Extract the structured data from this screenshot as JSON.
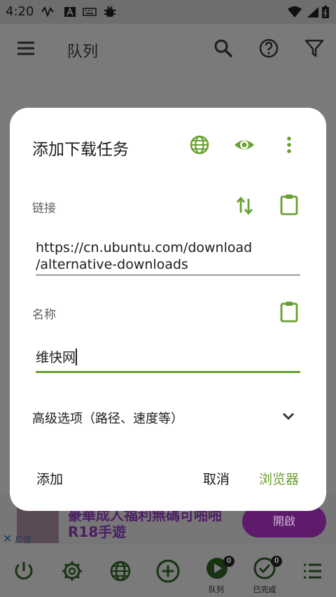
{
  "status_bar": {
    "time": "4:20"
  },
  "app_bar": {
    "title": "队列"
  },
  "dialog": {
    "title": "添加下载任务",
    "link_label": "链接",
    "link_value": "https://cn.ubuntu.com/download\n/alternative-downloads",
    "name_label": "名称",
    "name_value": "维快网",
    "advanced_label": "高级选项（路径、速度等）",
    "btn_add": "添加",
    "btn_cancel": "取消",
    "btn_browser": "浏览器"
  },
  "ad": {
    "text": "豪華成人福利無碼可啪啪R18手遊",
    "open_label": "開啟",
    "ad_label": "广告"
  },
  "bottom_nav": {
    "queue_label": "队列",
    "done_label": "已完成",
    "queue_badge": "0",
    "done_badge": "0"
  },
  "colors": {
    "accent": "#6aa033",
    "scrim": "#7a7a7a",
    "dialog_bg": "#ffffff"
  }
}
